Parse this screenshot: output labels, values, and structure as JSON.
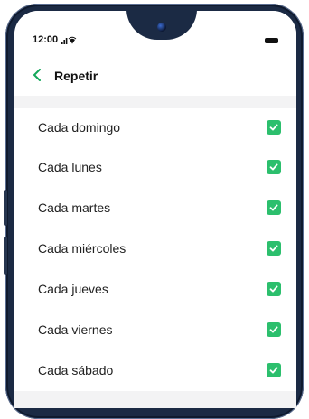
{
  "status_bar": {
    "time": "12:00",
    "signal": "ᴺᴵᴸ"
  },
  "header": {
    "title": "Repetir"
  },
  "days": [
    {
      "label": "Cada domingo",
      "checked": true
    },
    {
      "label": "Cada lunes",
      "checked": true
    },
    {
      "label": "Cada martes",
      "checked": true
    },
    {
      "label": "Cada miércoles",
      "checked": true
    },
    {
      "label": "Cada jueves",
      "checked": true
    },
    {
      "label": "Cada viernes",
      "checked": true
    },
    {
      "label": "Cada sábado",
      "checked": true
    }
  ],
  "colors": {
    "accent": "#2cbf6d",
    "back": "#14a85a",
    "frame": "#1b2a44"
  },
  "icons": {
    "back": "chevron-left-icon",
    "checkbox": "checkbox-checked-icon",
    "battery": "battery-icon",
    "wifi": "wifi-icon"
  }
}
